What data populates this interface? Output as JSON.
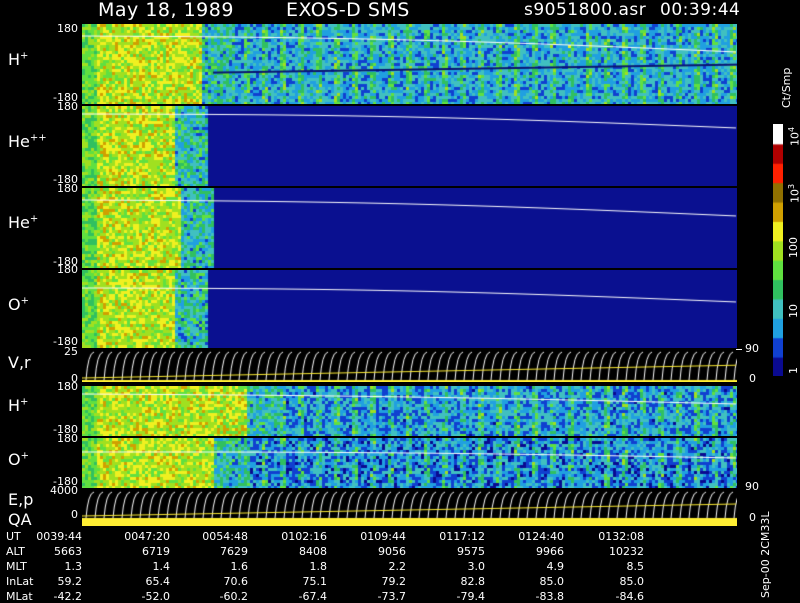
{
  "header": {
    "date": "May 18, 1989",
    "instrument": "EXOS-D SMS",
    "file": "s9051800.asr",
    "time": "00:39:44"
  },
  "panels": [
    {
      "species": "H",
      "charge": "+",
      "ytop": "180",
      "ybot": "-180"
    },
    {
      "species": "He",
      "charge": "++",
      "ytop": "180",
      "ybot": "-180"
    },
    {
      "species": "He",
      "charge": "+",
      "ytop": "180",
      "ybot": "-180"
    },
    {
      "species": "O",
      "charge": "+",
      "ytop": "180",
      "ybot": "-180"
    },
    {
      "species": "V,r",
      "charge": "",
      "ytop": "25",
      "ybot": "0",
      "rtop": "90",
      "rbot": "0"
    },
    {
      "species": "H",
      "charge": "+",
      "ytop": "180",
      "ybot": "-180"
    },
    {
      "species": "O",
      "charge": "+",
      "ytop": "180",
      "ybot": "-180"
    },
    {
      "species": "E,p",
      "charge": "",
      "ytop": "4000",
      "ybot": "0",
      "rtop": "90",
      "rbot": "0"
    }
  ],
  "qa_label": "QA",
  "colorbar": {
    "unit_label": "Ct/Smp",
    "ticks": [
      "1",
      "10",
      "100",
      "10",
      "10"
    ],
    "tick_exponents": [
      "",
      "",
      "",
      "3",
      "4"
    ],
    "colors": [
      "#0a0a90",
      "#1040d0",
      "#20a0e0",
      "#40c0c0",
      "#30c060",
      "#60e040",
      "#a0e020",
      "#f0f020",
      "#d0a000",
      "#907000",
      "#ff2000",
      "#b00000",
      "#ffffff"
    ]
  },
  "footer_note": "Sep-00 2CM33L",
  "table": {
    "row_labels": [
      "UT",
      "ALT",
      "MLT",
      "InLat",
      "MLat"
    ],
    "columns": [
      [
        "0039:44",
        "5663",
        "1.3",
        "59.2",
        "-42.2"
      ],
      [
        "0047:20",
        "6719",
        "1.4",
        "65.4",
        "-52.0"
      ],
      [
        "0054:48",
        "7629",
        "1.6",
        "70.6",
        "-60.2"
      ],
      [
        "0102:16",
        "8408",
        "1.8",
        "75.1",
        "-67.4"
      ],
      [
        "0109:44",
        "9056",
        "2.2",
        "79.2",
        "-73.7"
      ],
      [
        "0117:12",
        "9575",
        "3.0",
        "82.8",
        "-79.4"
      ],
      [
        "0124:40",
        "9966",
        "4.9",
        "85.0",
        "-83.8"
      ],
      [
        "0132:08",
        "10232",
        "8.5",
        "85.0",
        "-84.6"
      ]
    ]
  },
  "chart_data": {
    "type": "heatmap",
    "title": "May 18, 1989   EXOS-D SMS",
    "x_tick_labels": [
      "0039:44",
      "0047:20",
      "0054:48",
      "0102:16",
      "0109:44",
      "0117:12",
      "0124:40",
      "0132:08"
    ],
    "color_scale": "log",
    "color_range": [
      1,
      10000
    ],
    "color_unit": "Ct/Smp",
    "panels": [
      {
        "name": "H+",
        "y_range": [
          -180,
          180
        ],
        "high_flux_until_fraction": 0.18
      },
      {
        "name": "He++",
        "y_range": [
          -180,
          180
        ],
        "high_flux_until_fraction": 0.14
      },
      {
        "name": "He+",
        "y_range": [
          -180,
          180
        ],
        "high_flux_until_fraction": 0.15
      },
      {
        "name": "O+",
        "y_range": [
          -180,
          180
        ],
        "high_flux_until_fraction": 0.14
      },
      {
        "name": "V,r",
        "y_range": [
          0,
          25
        ],
        "right_range": [
          0,
          90
        ]
      },
      {
        "name": "H+",
        "y_range": [
          -180,
          180
        ],
        "high_flux_until_fraction": 0.25
      },
      {
        "name": "O+",
        "y_range": [
          -180,
          180
        ],
        "high_flux_until_fraction": 0.2
      },
      {
        "name": "E,p",
        "y_range": [
          0,
          4000
        ],
        "right_range": [
          0,
          90
        ]
      }
    ]
  }
}
